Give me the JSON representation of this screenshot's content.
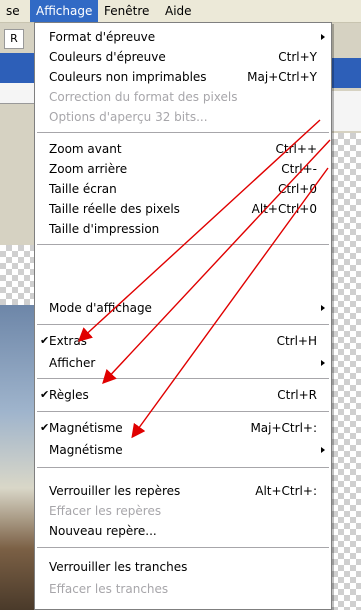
{
  "menubar": {
    "items": [
      {
        "label": "se"
      },
      {
        "label": "Affichage"
      },
      {
        "label": "Fenêtre"
      },
      {
        "label": "Aide"
      }
    ]
  },
  "toolbar": {
    "button_label": "R"
  },
  "menu": {
    "items": [
      {
        "label": "Format d'épreuve",
        "shortcut": "",
        "submenu": true,
        "disabled": false,
        "checked": false
      },
      {
        "label": "Couleurs d'épreuve",
        "shortcut": "Ctrl+Y",
        "submenu": false,
        "disabled": false,
        "checked": false
      },
      {
        "label": "Couleurs non imprimables",
        "shortcut": "Maj+Ctrl+Y",
        "submenu": false,
        "disabled": false,
        "checked": false
      },
      {
        "label": "Correction du format des pixels",
        "shortcut": "",
        "submenu": false,
        "disabled": true,
        "checked": false
      },
      {
        "label": "Options d'aperçu 32 bits...",
        "shortcut": "",
        "submenu": false,
        "disabled": true,
        "checked": false
      },
      {
        "label": "Zoom avant",
        "shortcut": "Ctrl++",
        "submenu": false,
        "disabled": false,
        "checked": false
      },
      {
        "label": "Zoom arrière",
        "shortcut": "Ctrl+-",
        "submenu": false,
        "disabled": false,
        "checked": false
      },
      {
        "label": "Taille écran",
        "shortcut": "Ctrl+0",
        "submenu": false,
        "disabled": false,
        "checked": false
      },
      {
        "label": "Taille réelle des pixels",
        "shortcut": "Alt+Ctrl+0",
        "submenu": false,
        "disabled": false,
        "checked": false
      },
      {
        "label": "Taille d'impression",
        "shortcut": "",
        "submenu": false,
        "disabled": false,
        "checked": false
      },
      {
        "label": "Mode d'affichage",
        "shortcut": "",
        "submenu": true,
        "disabled": false,
        "checked": false
      },
      {
        "label": "Extras",
        "shortcut": "Ctrl+H",
        "submenu": false,
        "disabled": false,
        "checked": true
      },
      {
        "label": "Afficher",
        "shortcut": "",
        "submenu": true,
        "disabled": false,
        "checked": false
      },
      {
        "label": "Règles",
        "shortcut": "Ctrl+R",
        "submenu": false,
        "disabled": false,
        "checked": true
      },
      {
        "label": "Magnétisme",
        "shortcut": "Maj+Ctrl+:",
        "submenu": false,
        "disabled": false,
        "checked": true
      },
      {
        "label": "Magnétisme",
        "shortcut": "",
        "submenu": true,
        "disabled": false,
        "checked": false
      },
      {
        "label": "Verrouiller les repères",
        "shortcut": "Alt+Ctrl+:",
        "submenu": false,
        "disabled": false,
        "checked": false
      },
      {
        "label": "Effacer les repères",
        "shortcut": "",
        "submenu": false,
        "disabled": true,
        "checked": false
      },
      {
        "label": "Nouveau repère...",
        "shortcut": "",
        "submenu": false,
        "disabled": false,
        "checked": false
      },
      {
        "label": "Verrouiller les tranches",
        "shortcut": "",
        "submenu": false,
        "disabled": false,
        "checked": false
      },
      {
        "label": "Effacer les tranches",
        "shortcut": "",
        "submenu": false,
        "disabled": true,
        "checked": false
      }
    ]
  },
  "checkmark": "✔",
  "annotation_color": "#e00000",
  "accent_color": "#316ac5"
}
